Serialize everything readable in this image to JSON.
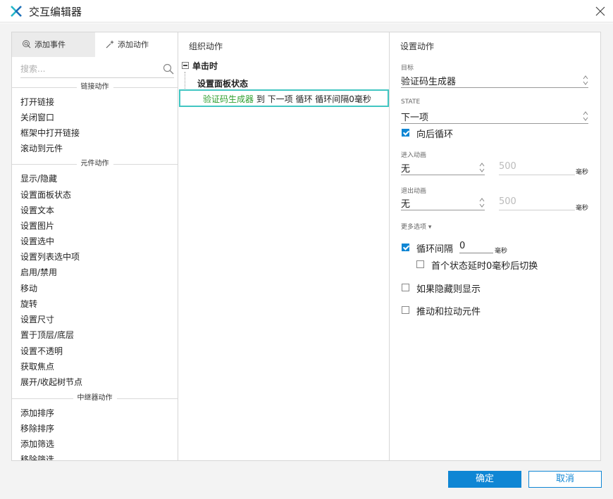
{
  "window": {
    "title": "交互编辑器"
  },
  "left": {
    "tabs": [
      {
        "label": "添加事件"
      },
      {
        "label": "添加动作"
      }
    ],
    "search_placeholder": "搜索...",
    "sections": [
      {
        "label": "链接动作",
        "items": [
          "打开链接",
          "关闭窗口",
          "框架中打开链接",
          "滚动到元件"
        ]
      },
      {
        "label": "元件动作",
        "items": [
          "显示/隐藏",
          "设置面板状态",
          "设置文本",
          "设置图片",
          "设置选中",
          "设置列表选中项",
          "启用/禁用",
          "移动",
          "旋转",
          "设置尺寸",
          "置于顶层/底层",
          "设置不透明",
          "获取焦点",
          "展开/收起树节点"
        ]
      },
      {
        "label": "中继器动作",
        "items": [
          "添加排序",
          "移除排序",
          "添加筛选",
          "移除筛选"
        ]
      }
    ]
  },
  "middle": {
    "title": "组织动作",
    "event": "单击时",
    "case": "设置面板状态",
    "action": {
      "target": "验证码生成器",
      "rest": " 到 下一项 循环 循环间隔0毫秒"
    }
  },
  "right": {
    "title": "设置动作",
    "target_label": "目标",
    "target_value": "验证码生成器",
    "state_label": "STATE",
    "state_value": "下一项",
    "wrap_label": "向后循环",
    "wrap_checked": true,
    "anim_in_label": "进入动画",
    "anim_in_value": "无",
    "anim_in_ms": "500",
    "anim_out_label": "退出动画",
    "anim_out_value": "无",
    "anim_out_ms": "500",
    "ms_unit": "毫秒",
    "more_options": "更多选项 ▾",
    "repeat_label": "循环间隔",
    "repeat_checked": true,
    "repeat_value": "0",
    "first_delay_label": "首个状态延时0毫秒后切换",
    "first_delay_checked": false,
    "show_if_hidden_label": "如果隐藏则显示",
    "show_if_hidden_checked": false,
    "push_pull_label": "推动和拉动元件",
    "push_pull_checked": false
  },
  "footer": {
    "ok": "确定",
    "cancel": "取消"
  }
}
